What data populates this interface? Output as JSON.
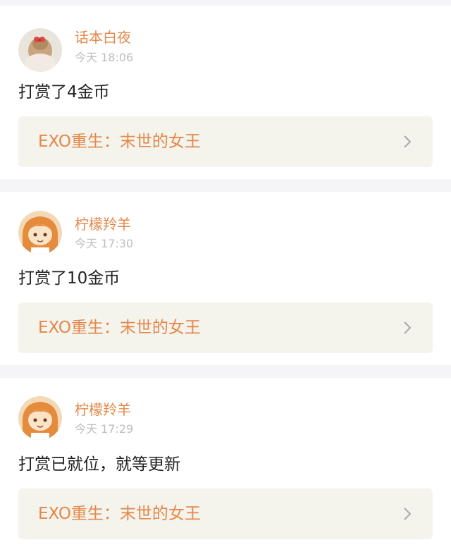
{
  "posts": [
    {
      "username": "话本白夜",
      "time": "今天 18:06",
      "message": "打赏了4金币",
      "book_title": "EXO重生：末世的女王",
      "avatar": "user-photo-avatar"
    },
    {
      "username": "柠檬羚羊",
      "time": "今天 17:30",
      "message": "打赏了10金币",
      "book_title": "EXO重生：末世的女王",
      "avatar": "anime-girl-avatar"
    },
    {
      "username": "柠檬羚羊",
      "time": "今天 17:29",
      "message": "打赏已就位，就等更新",
      "book_title": "EXO重生：末世的女王",
      "avatar": "anime-girl-avatar"
    }
  ],
  "colors": {
    "accent": "#e4884a",
    "time": "#bdbdbd",
    "text": "#222222",
    "link_bg": "#f4f3ec",
    "page_bg": "#f5f4f6"
  }
}
